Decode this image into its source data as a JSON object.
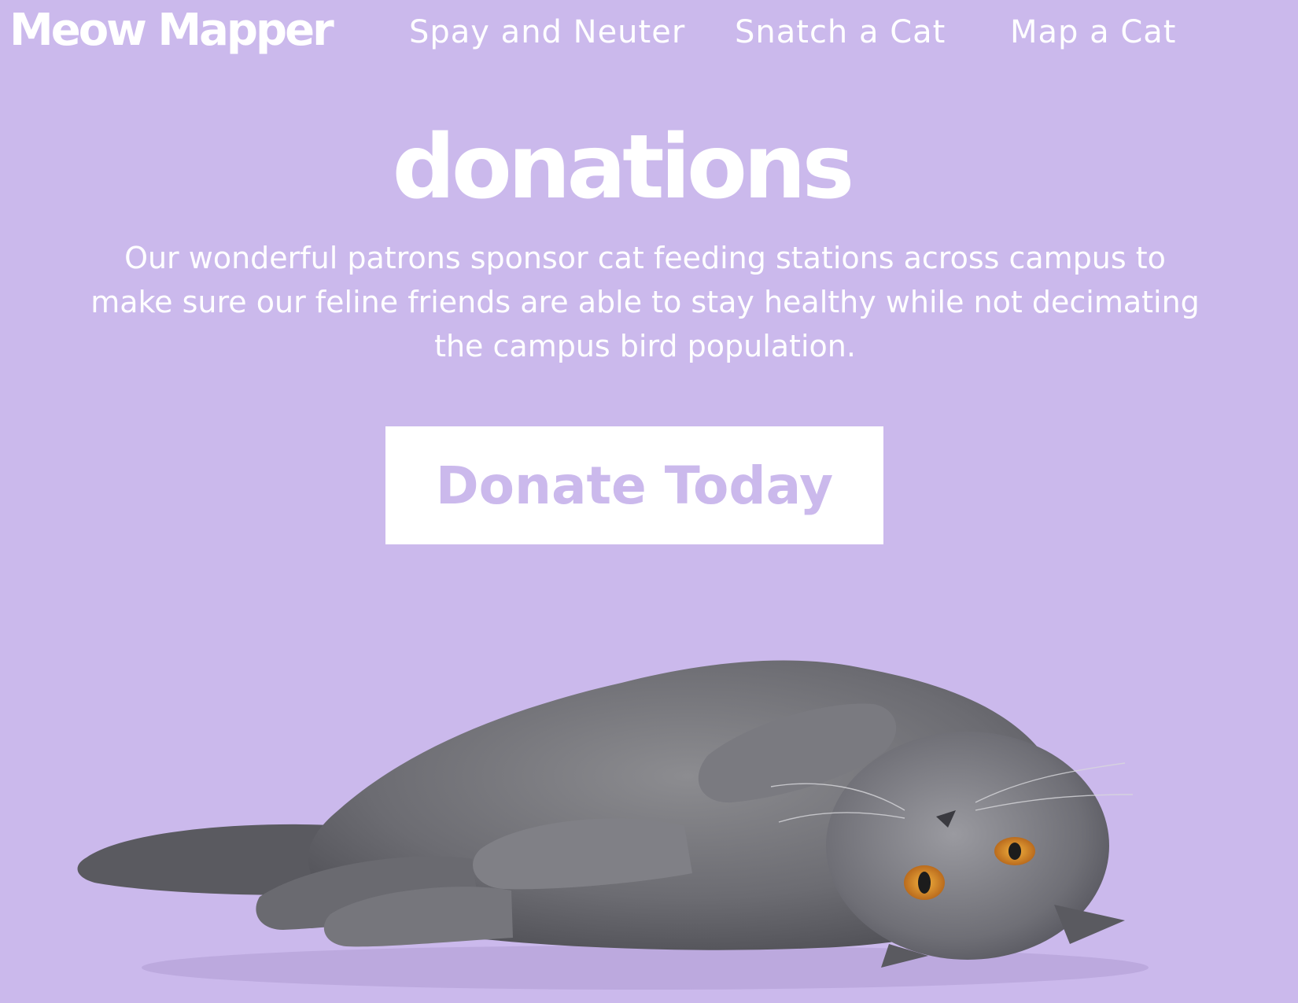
{
  "colors": {
    "background": "#cbb9ec",
    "text": "#ffffff",
    "button_background": "#ffffff",
    "button_text": "#cbb9ec"
  },
  "header": {
    "logo": "Meow Mapper",
    "nav": [
      "Spay and Neuter",
      "Snatch a Cat",
      "Map a Cat"
    ]
  },
  "main": {
    "title": "donations",
    "intro": "Our wonderful patrons sponsor cat feeding stations across campus to make sure our feline friends are able to stay  healthy while not decimating the campus bird population.",
    "cta_label": "Donate Today"
  },
  "hero_image": {
    "subject": "gray-cat-lying-on-side"
  }
}
